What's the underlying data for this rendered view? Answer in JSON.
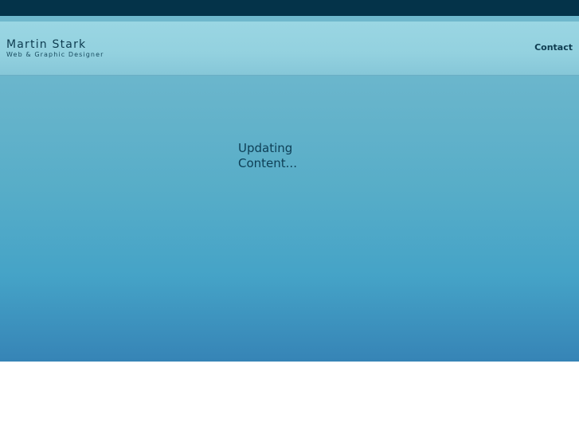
{
  "header": {
    "brand_name": "Martin Stark",
    "tagline": "Web & Graphic Designer",
    "nav": {
      "contact_label": "Contact"
    }
  },
  "main": {
    "status_message": "Updating Content..."
  },
  "colors": {
    "top_strip": "#043349",
    "header_bg": "#9ad6e3",
    "main_gradient_top": "#6bb6cc",
    "main_gradient_bottom": "#3684b6",
    "text_dark": "#0e3c50"
  }
}
